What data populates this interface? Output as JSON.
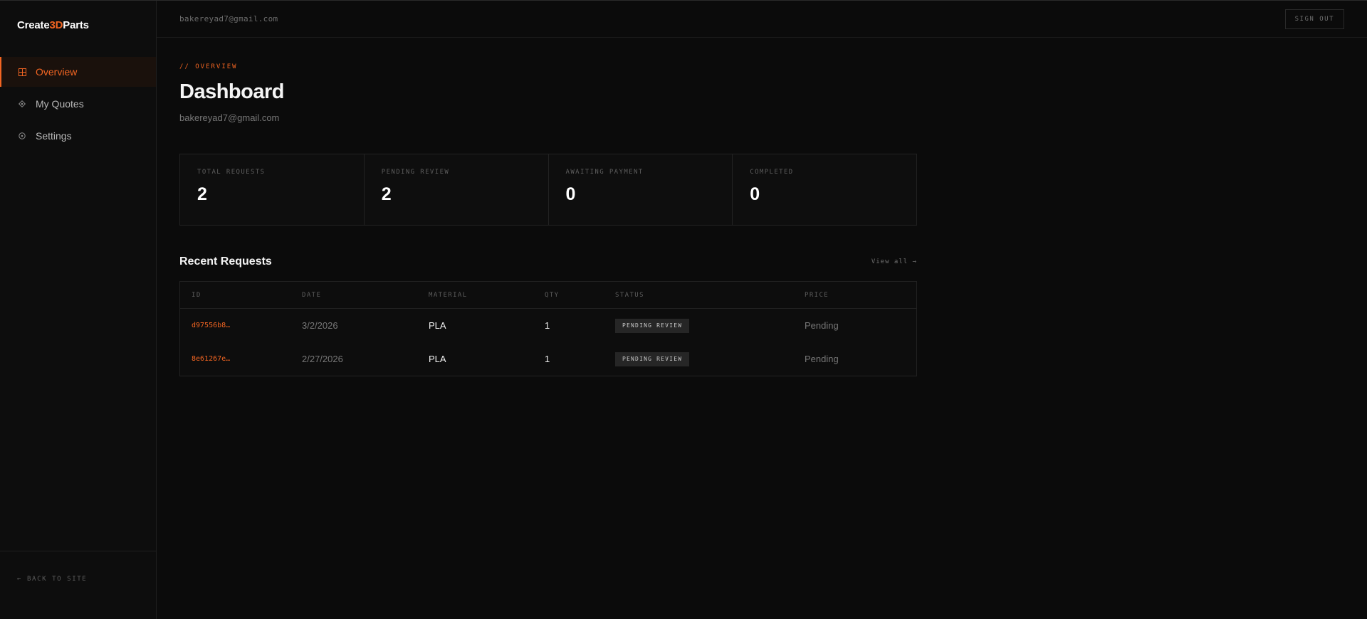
{
  "brand": {
    "prefix": "Create",
    "accent": "3D",
    "suffix": "Parts"
  },
  "sidebar": {
    "items": [
      {
        "label": "Overview",
        "icon": "grid-icon",
        "active": true
      },
      {
        "label": "My Quotes",
        "icon": "diamond-icon",
        "active": false
      },
      {
        "label": "Settings",
        "icon": "gear-icon",
        "active": false
      }
    ],
    "footer": "← BACK TO SITE"
  },
  "topbar": {
    "email": "bakereyad7@gmail.com",
    "signout_label": "SIGN OUT"
  },
  "header": {
    "eyebrow": "// OVERVIEW",
    "title": "Dashboard",
    "subtitle": "bakereyad7@gmail.com"
  },
  "stats": [
    {
      "label": "TOTAL REQUESTS",
      "value": "2"
    },
    {
      "label": "PENDING REVIEW",
      "value": "2"
    },
    {
      "label": "AWAITING PAYMENT",
      "value": "0"
    },
    {
      "label": "COMPLETED",
      "value": "0"
    }
  ],
  "recent": {
    "title": "Recent Requests",
    "view_all": "View all →",
    "columns": [
      "ID",
      "DATE",
      "MATERIAL",
      "QTY",
      "STATUS",
      "PRICE"
    ],
    "rows": [
      {
        "id": "d97556b8…",
        "date": "3/2/2026",
        "material": "PLA",
        "qty": "1",
        "status": "PENDING REVIEW",
        "price": "Pending"
      },
      {
        "id": "8e61267e…",
        "date": "2/27/2026",
        "material": "PLA",
        "qty": "1",
        "status": "PENDING REVIEW",
        "price": "Pending"
      }
    ]
  },
  "colors": {
    "accent": "#f26522",
    "background": "#0b0b0b",
    "sidebar": "#0d0d0d"
  }
}
